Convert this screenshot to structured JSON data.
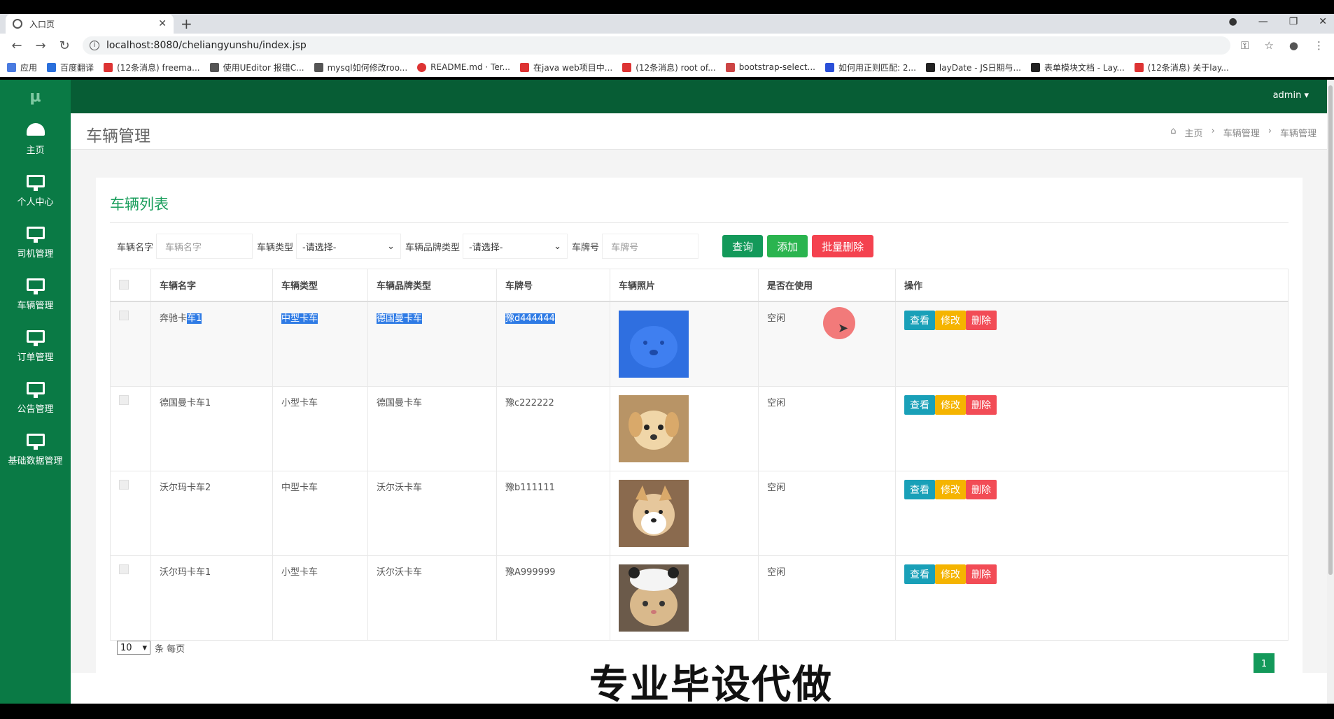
{
  "browser": {
    "tab_title": "入口页",
    "url": "localhost:8080/cheliangyunshu/index.jsp",
    "bookmarks": [
      "应用",
      "百度翻译",
      "(12条消息) freema...",
      "使用UEditor 报错C...",
      "mysql如何修改roo...",
      "README.md · Ter...",
      "在java web项目中...",
      "(12条消息) root of...",
      "bootstrap-select...",
      "如何用正则匹配: 2...",
      "layDate - JS日期与...",
      "表单模块文档 - Lay...",
      "(12条消息) 关于lay..."
    ]
  },
  "app": {
    "logo": "μ",
    "user": "admin",
    "sidebar": [
      {
        "label": "主页",
        "icon": "dashboard-icon"
      },
      {
        "label": "个人中心",
        "icon": "monitor-icon"
      },
      {
        "label": "司机管理",
        "icon": "monitor-icon"
      },
      {
        "label": "车辆管理",
        "icon": "monitor-icon"
      },
      {
        "label": "订单管理",
        "icon": "monitor-icon"
      },
      {
        "label": "公告管理",
        "icon": "monitor-icon"
      },
      {
        "label": "基础数据管理",
        "icon": "monitor-icon"
      }
    ],
    "page_title": "车辆管理",
    "breadcrumb": [
      "主页",
      "车辆管理",
      "车辆管理"
    ],
    "panel_title": "车辆列表",
    "filters": {
      "name_label": "车辆名字",
      "name_placeholder": "车辆名字",
      "type_label": "车辆类型",
      "type_value": "-请选择-",
      "brand_label": "车辆品牌类型",
      "brand_value": "-请选择-",
      "plate_label": "车牌号",
      "plate_placeholder": "车牌号",
      "search_btn": "查询",
      "add_btn": "添加",
      "batch_delete_btn": "批量删除"
    },
    "table": {
      "headers": [
        "车辆名字",
        "车辆类型",
        "车辆品牌类型",
        "车牌号",
        "车辆照片",
        "是否在使用",
        "操作"
      ],
      "rows": [
        {
          "name_a": "奔驰卡",
          "name_b": "车1",
          "type": "中型卡车",
          "brand": "德国曼卡车",
          "plate": "豫d444444",
          "status": "空闲"
        },
        {
          "name_a": "德国曼卡车1",
          "name_b": "",
          "type": "小型卡车",
          "brand": "德国曼卡车",
          "plate": "豫c222222",
          "status": "空闲"
        },
        {
          "name_a": "沃尔玛卡车2",
          "name_b": "",
          "type": "中型卡车",
          "brand": "沃尔沃卡车",
          "plate": "豫b111111",
          "status": "空闲"
        },
        {
          "name_a": "沃尔玛卡车1",
          "name_b": "",
          "type": "小型卡车",
          "brand": "沃尔沃卡车",
          "plate": "豫A999999",
          "status": "空闲"
        }
      ],
      "ops": {
        "view": "查看",
        "edit": "修改",
        "delete": "删除"
      }
    },
    "pager": {
      "page_size": "10",
      "per_page_label": "条 每页",
      "current_page": "1"
    },
    "watermark": "专业毕设代做"
  }
}
